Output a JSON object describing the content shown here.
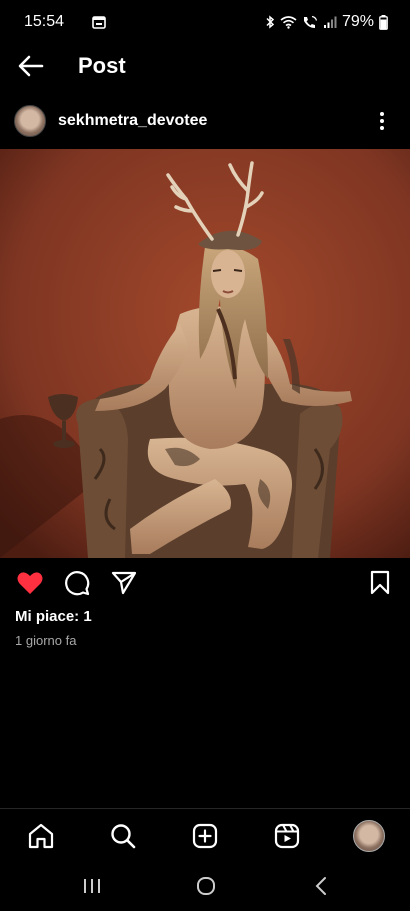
{
  "status_bar": {
    "time": "15:54",
    "battery": "79%"
  },
  "header": {
    "title": "Post"
  },
  "post": {
    "username": "sekhmetra_devotee",
    "likes": "Mi piace: 1",
    "time_ago": "1 giorno fa",
    "liked": true
  },
  "colors": {
    "like_red": "#ff3040",
    "background": "#000000",
    "secondary_text": "#a8a8a8"
  },
  "icons": {
    "back": "arrow-left-icon",
    "more": "more-vertical-icon",
    "like": "heart-icon",
    "comment": "comment-icon",
    "share": "send-icon",
    "save": "bookmark-icon",
    "home": "home-icon",
    "search": "search-icon",
    "create": "add-square-icon",
    "reels": "reels-icon"
  }
}
